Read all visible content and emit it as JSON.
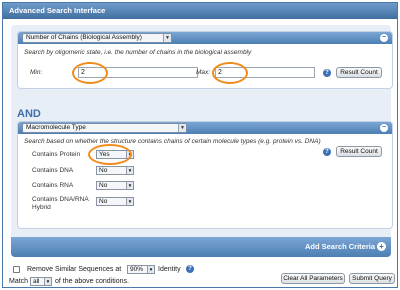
{
  "title": "Advanced Search Interface",
  "section1": {
    "query_type": "Number of Chains (Biological Assembly)",
    "description": "Search by oligomeric state, i.e. the number of chains in the biological assembly",
    "min_label": "Min:",
    "min_value": "2",
    "max_label": "Max:",
    "max_value": "2",
    "help_icon": "?",
    "result_count_label": "Result Count",
    "collapse_icon": "−"
  },
  "and_label": "AND",
  "section2": {
    "query_type": "Macromolecule Type",
    "description": "Search based on whether the structure contains chains of certain molecule types (e.g. protein vs. DNA)",
    "help_icon": "?",
    "result_count_label": "Result Count",
    "collapse_icon": "−",
    "rows": [
      {
        "label": "Contains Protein",
        "value": "Yes"
      },
      {
        "label": "Contains DNA",
        "value": "No"
      },
      {
        "label": "Contains RNA",
        "value": "No"
      },
      {
        "label": "Contains DNA/RNA Hybrid",
        "value": "No"
      }
    ]
  },
  "add_criteria": "Add Search Criteria",
  "footer": {
    "remove_similar": "Remove Similar Sequences at",
    "identity_value": "90%",
    "identity_label": "Identity",
    "match_label": "Match",
    "match_value": "all",
    "match_suffix": "of the above conditions.",
    "clear_button": "Clear All Parameters",
    "submit_button": "Submit Query"
  },
  "colors": {
    "accent": "#4d7fb3",
    "highlight_ring": "#f28a1a"
  }
}
